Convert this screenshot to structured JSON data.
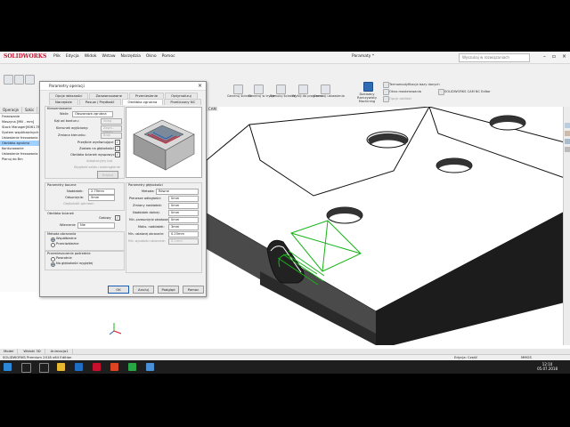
{
  "app": {
    "logo": "SOLIDWORKS",
    "menu": [
      "Plik",
      "Edycja",
      "Widok",
      "Wstaw",
      "Narzędzia",
      "Okno",
      "Pomoc"
    ],
    "document_title": "Paramaty *",
    "search_placeholder": "Wyszukaj w rozwiązaniach"
  },
  "command_manager": {
    "items": [
      "Generuj ścieżki",
      "Generuj w trybie",
      "Symuluj ścieżkę",
      "Wyślij do programu",
      "Generuj ustawienia",
      "Termomodyfikacja bazy danych",
      "Okno masterowania",
      "Opcje obróbki",
      "SOLIDWORKS CAM NC Editor"
    ],
    "highlight": "Dokładny Rzeczywisty Machining"
  },
  "tabs": [
    "Operacje",
    "Szkic",
    "Oblicz",
    "Narzędzia"
  ],
  "tree": {
    "items": [
      "Frezowanie",
      "Maszyna [Mill - mm]",
      "Stock Manager[6061-T6]",
      "System współrzędnych",
      "Ustawienie frezowania",
      "Obróbka zgrubna",
      "Konturowanie",
      "Ustawienie frezowania",
      "Planuj do Bm"
    ],
    "selected_index": 5
  },
  "dialog": {
    "title": "Parametry operacji",
    "tabs_row1": [
      "Opcje własności",
      "Zaawansowane",
      "Przeniesienie",
      "Optymalizuj"
    ],
    "tabs_row2": [
      "Narzędzie",
      "Posuw / Prędkość",
      "Obróbka zgrubna",
      "Przeliczony NC"
    ],
    "active_tab": "Obróbka zgrubna",
    "kieszeniowanie_label": "Kieszeniowanie",
    "wzor_label": "Wzór:",
    "wzor_value": "Obszarowa zgrubna",
    "kat_label": "Kąt od konturu:",
    "kat_value": "0deg",
    "kierunek_label": "Kierunek wyjściowy:",
    "kierunek_value": "Zewn.-Wewn.",
    "zmiana_label": "Zmiana kierunku:",
    "zmiana_value": "Brak",
    "chk1": "Przejście wyrównujące",
    "chk2": "Zostaw na głębokości",
    "chk3": "Obróbka ścianek wyspowych",
    "adapt_label": "Adaptacyjny kąt",
    "wygla_label": "Wygładź szlaku zaokrąglenie",
    "edit_btn": "Edytuj",
    "parametry_boczne_label": "Parametry boczne",
    "naddatek_label": "Naddatek:",
    "naddatek_value": "2.79mm",
    "odsuniecie_label": "Odsunięcie:",
    "odsuniecie_value": "5mm",
    "glebokosc_label": "Głębokość górnaen",
    "obrobka_wiekszych": "Obróbka ścianek",
    "gotowy_label": "Gotowy",
    "wiercenie_label": "Wiercenie",
    "wiercenie_value": "Nie",
    "metoda_label": "Metoda obracania",
    "rad_wspol": "Współbieżne",
    "rad_przeciw": "Przeciwbieżne",
    "przemieszczenie_label": "Przemieszczenie pośrednie",
    "rad_powrot": "Powrotnie",
    "rad_gleb": "Na głębokości wygiętej",
    "parametry_glebokosci": "Parametry głębokości",
    "metoda2_label": "Metoda:",
    "metoda2_value": "Równe",
    "pierwsze_label": "Pierwsze odległości:",
    "pierwsze_value": "0mm",
    "zmiany_label": "Zmiany naddatek:",
    "zmiany_value": "0mm",
    "naddatek_dna_label": "Naddatek dolnej:",
    "naddatek_dna_value": "0mm",
    "min_przesun_label": "Min. przesunięcie obrotowe:",
    "min_przesun_value": "0mm",
    "maks_label": "Maks. naddatek:",
    "maks_value": "3mm",
    "min_ustalony_label": "Min. ustalonej obracanie:",
    "min_ustalony_value": "0.25mm",
    "min_odkrycia_label": "Min. wysokości obracanie:",
    "min_odkrycia_value": "0.1mm",
    "buttons": [
      "OK",
      "Anuluj",
      "Podgląd",
      "Pomoc"
    ]
  },
  "bottom_tabs": [
    "Model",
    "Widoki 3D",
    "Animacja1"
  ],
  "status": {
    "left": "SOLIDWORKS Premium 2018 x64 Edition",
    "middle": "Edycja: Część",
    "units": "MMGS"
  },
  "clock": {
    "time": "12:10",
    "date": "05.07.2018"
  }
}
